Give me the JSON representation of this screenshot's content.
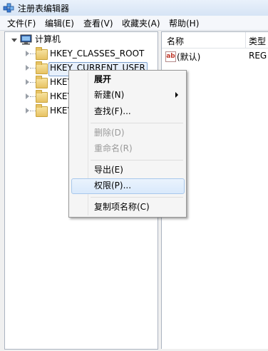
{
  "window": {
    "title": "注册表编辑器"
  },
  "menu": [
    "文件(F)",
    "编辑(E)",
    "查看(V)",
    "收藏夹(A)",
    "帮助(H)"
  ],
  "tree": {
    "root": "计算机",
    "nodes": [
      "HKEY_CLASSES_ROOT",
      "HKEY_CURRENT_USER",
      "HKEY",
      "HKEY",
      "HKEY"
    ]
  },
  "list": {
    "columns": {
      "name": "名称",
      "type": "类型"
    },
    "rows": [
      {
        "name": "(默认)",
        "type": "REG"
      }
    ],
    "value_icon_text": "ab"
  },
  "context_menu": {
    "items": [
      "展开",
      "新建(N)",
      "查找(F)...",
      "删除(D)",
      "重命名(R)",
      "导出(E)",
      "权限(P)...",
      "复制项名称(C)"
    ],
    "highlighted": "权限(P)..."
  }
}
